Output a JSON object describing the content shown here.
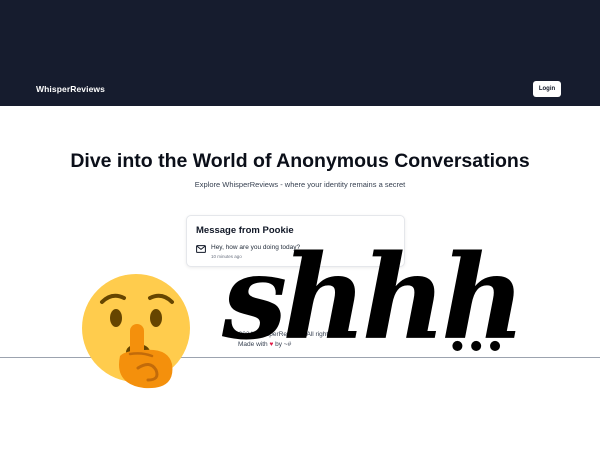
{
  "header": {
    "brand": "WhisperReviews",
    "login_label": "Login"
  },
  "hero": {
    "title": "Dive into the World of Anonymous Conversations",
    "subtitle": "Explore WhisperReviews - where your identity remains a secret"
  },
  "message_card": {
    "title": "Message from Pookie",
    "icon": "mail-icon",
    "text": "Hey, how are you doing today?",
    "time": "10 minutes ago"
  },
  "footer": {
    "copyright_partial": "© 2024 WhisperReviews. All rights re",
    "made_with_partial": "Made with",
    "made_by_partial": "by ~#"
  },
  "overlay": {
    "emoji": "shushing-face-emoji",
    "text": "shhh",
    "ellipsis": "..."
  },
  "colors": {
    "header_bg": "#161c2e",
    "emoji_face": "#ffcc4d",
    "heart": "#e11d48"
  }
}
